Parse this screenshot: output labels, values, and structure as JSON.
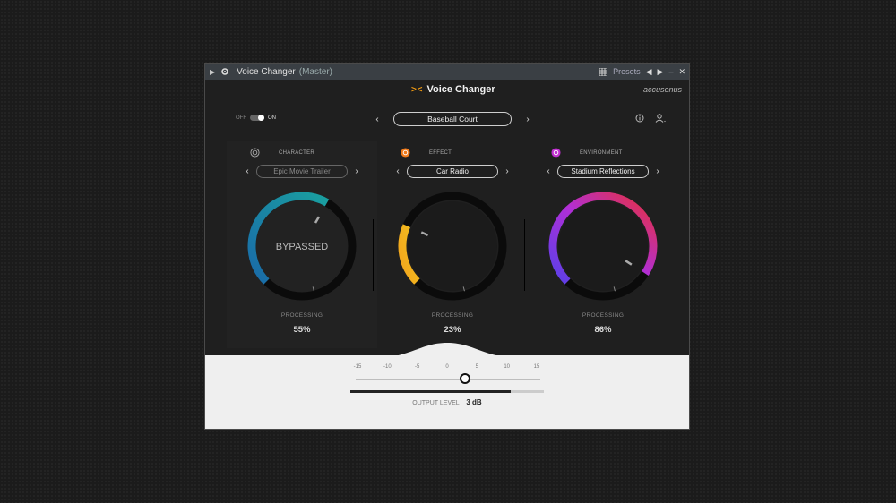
{
  "titlebar": {
    "title": "Voice Changer",
    "subtitle": "(Master)",
    "presets_label": "Presets"
  },
  "header": {
    "brand_mark": "> <",
    "brand": "Voice Changer",
    "maker": "accusonus"
  },
  "power": {
    "off_label": "OFF",
    "on_label": "ON",
    "state": "on"
  },
  "preset": {
    "name": "Baseball Court"
  },
  "panels": [
    {
      "title": "CHARACTER",
      "preset": "Epic Movie Trailer",
      "status": "BYPASSED",
      "processing_label": "PROCESSING",
      "processing": "55%",
      "value": 0.55,
      "color": "#1a6aa8",
      "enabled": false
    },
    {
      "title": "EFFECT",
      "preset": "Car Radio",
      "processing_label": "PROCESSING",
      "processing": "23%",
      "value": 0.23,
      "color": "#f2a41e",
      "enabled": true
    },
    {
      "title": "ENVIRONMENT",
      "preset": "Stadium Reflections",
      "processing_label": "PROCESSING",
      "processing": "86%",
      "value": 0.86,
      "color": "#8b3fe0",
      "enabled": true
    }
  ],
  "output": {
    "scale": [
      "-15",
      "-10",
      "-5",
      "0",
      "5",
      "10",
      "15"
    ],
    "label": "OUTPUT LEVEL",
    "value_text": "3 dB",
    "value_db": 3,
    "meter_level": 0.83
  }
}
